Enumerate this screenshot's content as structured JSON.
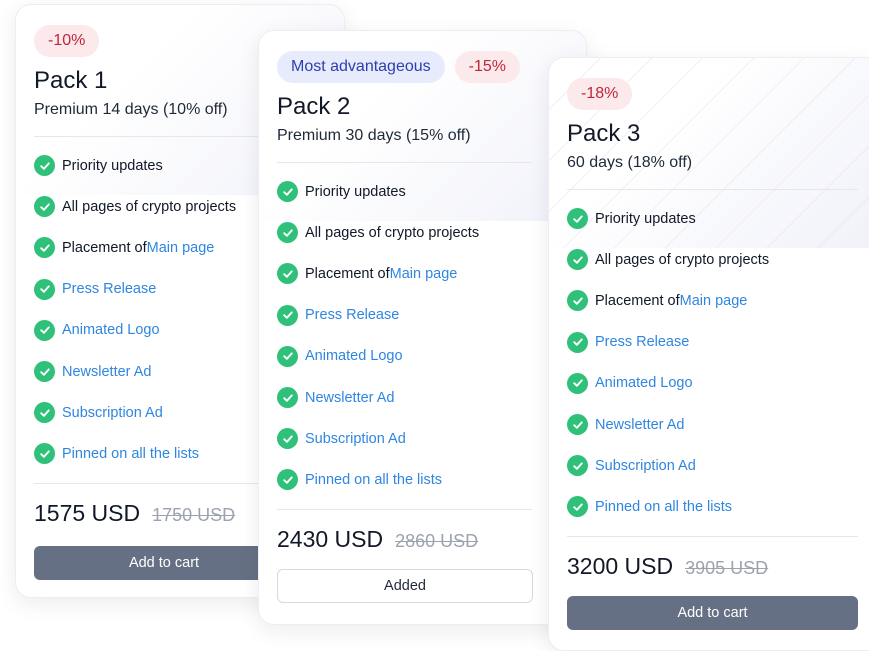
{
  "colors": {
    "accent_link": "#2f86e0",
    "check_green": "#2fc07a",
    "discount_text": "#c0263a",
    "best_text": "#2c3fb0",
    "button_primary": "#667084"
  },
  "packs": [
    {
      "discount": "-10%",
      "title": "Pack 1",
      "subtitle": "Premium 14 days (10% off)",
      "features": [
        {
          "prefix": "Priority updates",
          "link": ""
        },
        {
          "prefix": "All pages of crypto projects",
          "link": ""
        },
        {
          "prefix": "Placement of ",
          "link": "Main page"
        },
        {
          "prefix": "",
          "link": "Press Release"
        },
        {
          "prefix": "",
          "link": "Animated Logo"
        },
        {
          "prefix": "",
          "link": "Newsletter Ad"
        },
        {
          "prefix": "",
          "link": "Subscription Ad"
        },
        {
          "prefix": "",
          "link": "Pinned on all the lists"
        }
      ],
      "price": "1575 USD",
      "old_price": "1750 USD",
      "button": "Add to cart"
    },
    {
      "badge": "Most advantageous",
      "discount": "-15%",
      "title": "Pack 2",
      "subtitle": "Premium 30 days (15% off)",
      "features": [
        {
          "prefix": "Priority updates",
          "link": ""
        },
        {
          "prefix": "All pages of crypto projects",
          "link": ""
        },
        {
          "prefix": "Placement of ",
          "link": "Main page"
        },
        {
          "prefix": "",
          "link": "Press Release"
        },
        {
          "prefix": "",
          "link": "Animated Logo"
        },
        {
          "prefix": "",
          "link": "Newsletter Ad"
        },
        {
          "prefix": "",
          "link": "Subscription Ad"
        },
        {
          "prefix": "",
          "link": "Pinned on all the lists"
        }
      ],
      "price": "2430 USD",
      "old_price": "2860 USD",
      "button": "Added"
    },
    {
      "discount": "-18%",
      "title": "Pack 3",
      "subtitle": "60 days (18% off)",
      "features": [
        {
          "prefix": "Priority updates",
          "link": ""
        },
        {
          "prefix": "All pages of crypto projects",
          "link": ""
        },
        {
          "prefix": "Placement of ",
          "link": "Main page"
        },
        {
          "prefix": "",
          "link": "Press Release"
        },
        {
          "prefix": "",
          "link": "Animated Logo"
        },
        {
          "prefix": "",
          "link": "Newsletter Ad"
        },
        {
          "prefix": "",
          "link": "Subscription Ad"
        },
        {
          "prefix": "",
          "link": "Pinned on all the lists"
        }
      ],
      "price": "3200 USD",
      "old_price": "3905 USD",
      "button": "Add to cart"
    }
  ]
}
